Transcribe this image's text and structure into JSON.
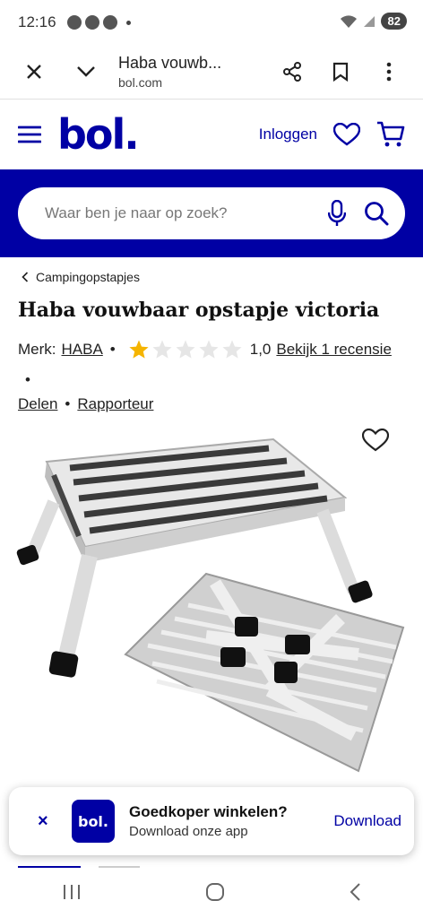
{
  "status": {
    "time": "12:16",
    "battery": "82"
  },
  "browser": {
    "title": "Haba vouwb...",
    "domain": "bol.com"
  },
  "header": {
    "logo": "bol.",
    "login": "Inloggen"
  },
  "search": {
    "placeholder": "Waar ben je naar op zoek?"
  },
  "breadcrumb": {
    "label": "Campingopstapjes"
  },
  "product": {
    "title": "Haba vouwbaar opstapje victoria",
    "brand_label": "Merk:",
    "brand": "HABA",
    "rating": "1,0",
    "rating_value": 1,
    "rating_max": 5,
    "reviews": "Bekijk 1 recensie",
    "share": "Delen",
    "report": "Rapporteur"
  },
  "banner": {
    "close": "×",
    "app_logo": "bol.",
    "title": "Goedkoper winkelen?",
    "subtitle": "Download onze app",
    "action": "Download"
  },
  "colors": {
    "brand": "#0000a4",
    "star": "#f5b400",
    "star_empty": "#e6e6e6"
  }
}
